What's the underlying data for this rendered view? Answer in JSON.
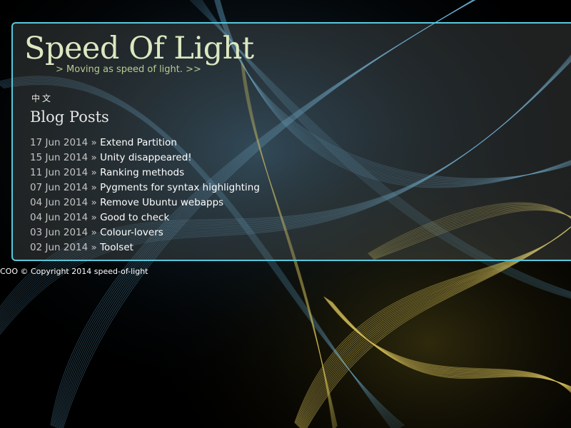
{
  "header": {
    "title": "Speed Of Light",
    "tagline": "> Moving as speed of light. >>"
  },
  "language_link": "中文",
  "posts_section": {
    "heading": "Blog Posts",
    "separator": "»",
    "posts": [
      {
        "date": "17 Jun 2014",
        "title": "Extend Partition"
      },
      {
        "date": "15 Jun 2014",
        "title": "Unity disappeared!"
      },
      {
        "date": "11 Jun 2014",
        "title": "Ranking methods"
      },
      {
        "date": "07 Jun 2014",
        "title": "Pygments for syntax highlighting"
      },
      {
        "date": "04 Jun 2014",
        "title": "Remove Ubuntu webapps"
      },
      {
        "date": "04 Jun 2014",
        "title": "Good to check"
      },
      {
        "date": "03 Jun 2014",
        "title": "Colour-lovers"
      },
      {
        "date": "02 Jun 2014",
        "title": "Toolset"
      }
    ]
  },
  "footer": {
    "text": "COO © Copyright 2014 speed-of-light"
  },
  "colors": {
    "panel_border": "#56c8dc",
    "title": "#dce8c0",
    "tagline": "#b6cc90",
    "background": "#000000",
    "wisp_blue": "#6fb8e0",
    "wisp_yellow": "#d8c25a"
  }
}
